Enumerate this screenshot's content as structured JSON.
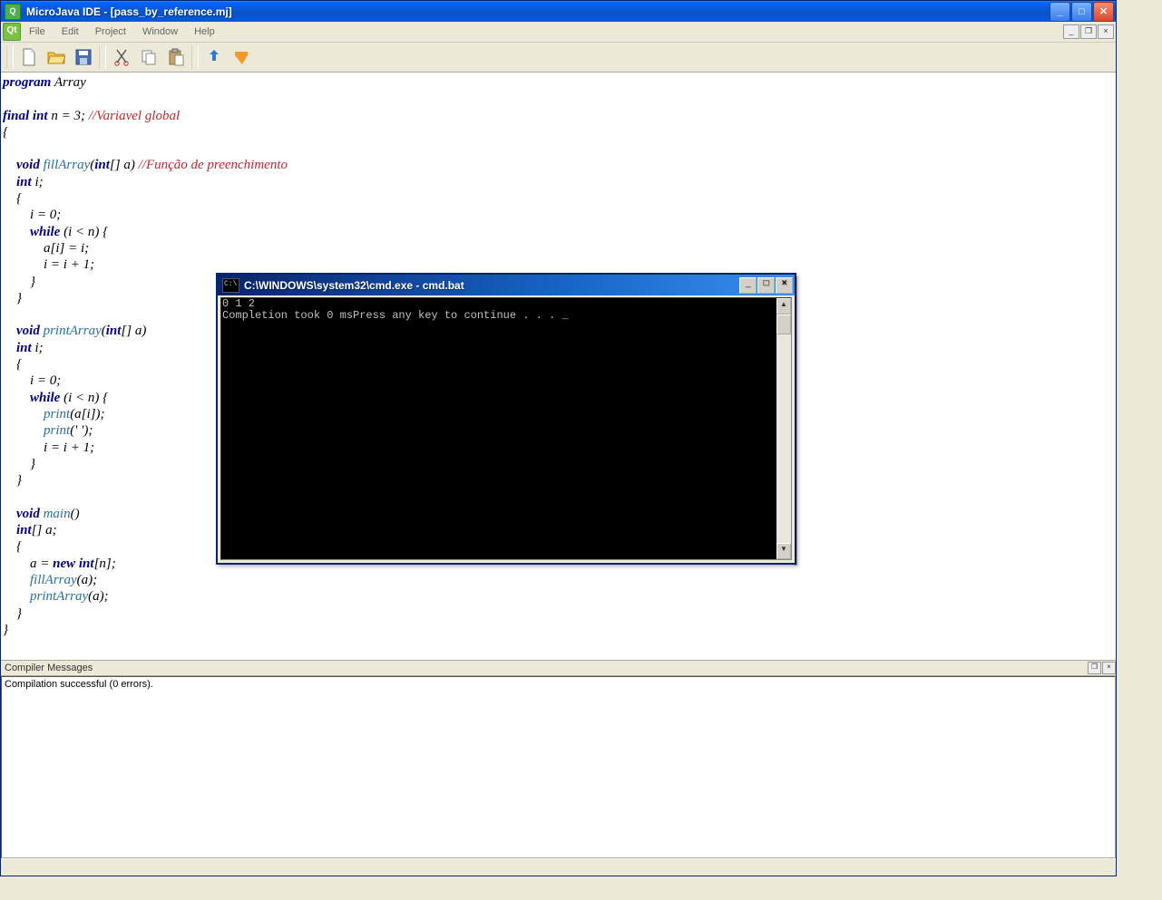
{
  "window": {
    "title": "MicroJava IDE - [pass_by_reference.mj]"
  },
  "menu": {
    "items": [
      "File",
      "Edit",
      "Project",
      "Window",
      "Help"
    ]
  },
  "toolbar": {
    "icons": [
      "new-file-icon",
      "open-file-icon",
      "save-icon",
      "cut-icon",
      "copy-icon",
      "paste-icon",
      "run-icon",
      "debug-icon"
    ]
  },
  "code": {
    "l1": {
      "kw": "program",
      "rest": " Array"
    },
    "l2": "",
    "l3": {
      "kw": "final int",
      "mid": " n = 3; ",
      "cmnt": "//Variavel global"
    },
    "l4": "{",
    "l5": "",
    "l6": {
      "pre": "    ",
      "kw": "void ",
      "id": "fillArray",
      "sig": "(",
      "kw2": "int",
      "sig2": "[] a) ",
      "cmnt": "//Função de preenchimento"
    },
    "l7": {
      "pre": "    ",
      "kw": "int",
      "rest": " i;"
    },
    "l8": "    {",
    "l9": "        i = 0;",
    "l10": {
      "pre": "        ",
      "kw": "while",
      "rest": " (i < n) {"
    },
    "l11": "            a[i] = i;",
    "l12": "            i = i + 1;",
    "l13": "        }",
    "l14": "    }",
    "l15": "",
    "l16": {
      "pre": "    ",
      "kw": "void ",
      "id": "printArray",
      "sig": "(",
      "kw2": "int",
      "sig2": "[] a)"
    },
    "l17": {
      "pre": "    ",
      "kw": "int",
      "rest": " i;"
    },
    "l18": "    {",
    "l19": "        i = 0;",
    "l20": {
      "pre": "        ",
      "kw": "while",
      "rest": " (i < n) {"
    },
    "l21": {
      "pre": "            ",
      "id": "print",
      "rest": "(a[i]);"
    },
    "l22": {
      "pre": "            ",
      "id": "print",
      "rest": "(' ');"
    },
    "l23": "            i = i + 1;",
    "l24": "        }",
    "l25": "    }",
    "l26": "",
    "l27": {
      "pre": "    ",
      "kw": "void ",
      "id": "main",
      "rest": "()"
    },
    "l28": {
      "pre": "    ",
      "kw": "int",
      "rest": "[] a;"
    },
    "l29": "    {",
    "l30": {
      "pre": "        a = ",
      "kw": "new int",
      "rest": "[n];"
    },
    "l31": {
      "pre": "        ",
      "id": "fillArray",
      "rest": "(a);"
    },
    "l32": {
      "pre": "        ",
      "id": "printArray",
      "rest": "(a);"
    },
    "l33": "    }",
    "l34": "}"
  },
  "compiler_panel": {
    "title": "Compiler Messages",
    "message": "Compilation successful (0 errors)."
  },
  "cmd": {
    "title": "C:\\WINDOWS\\system32\\cmd.exe - cmd.bat",
    "line1": "0 1 2 ",
    "line2": "Completion took 0 msPress any key to continue . . . _"
  }
}
